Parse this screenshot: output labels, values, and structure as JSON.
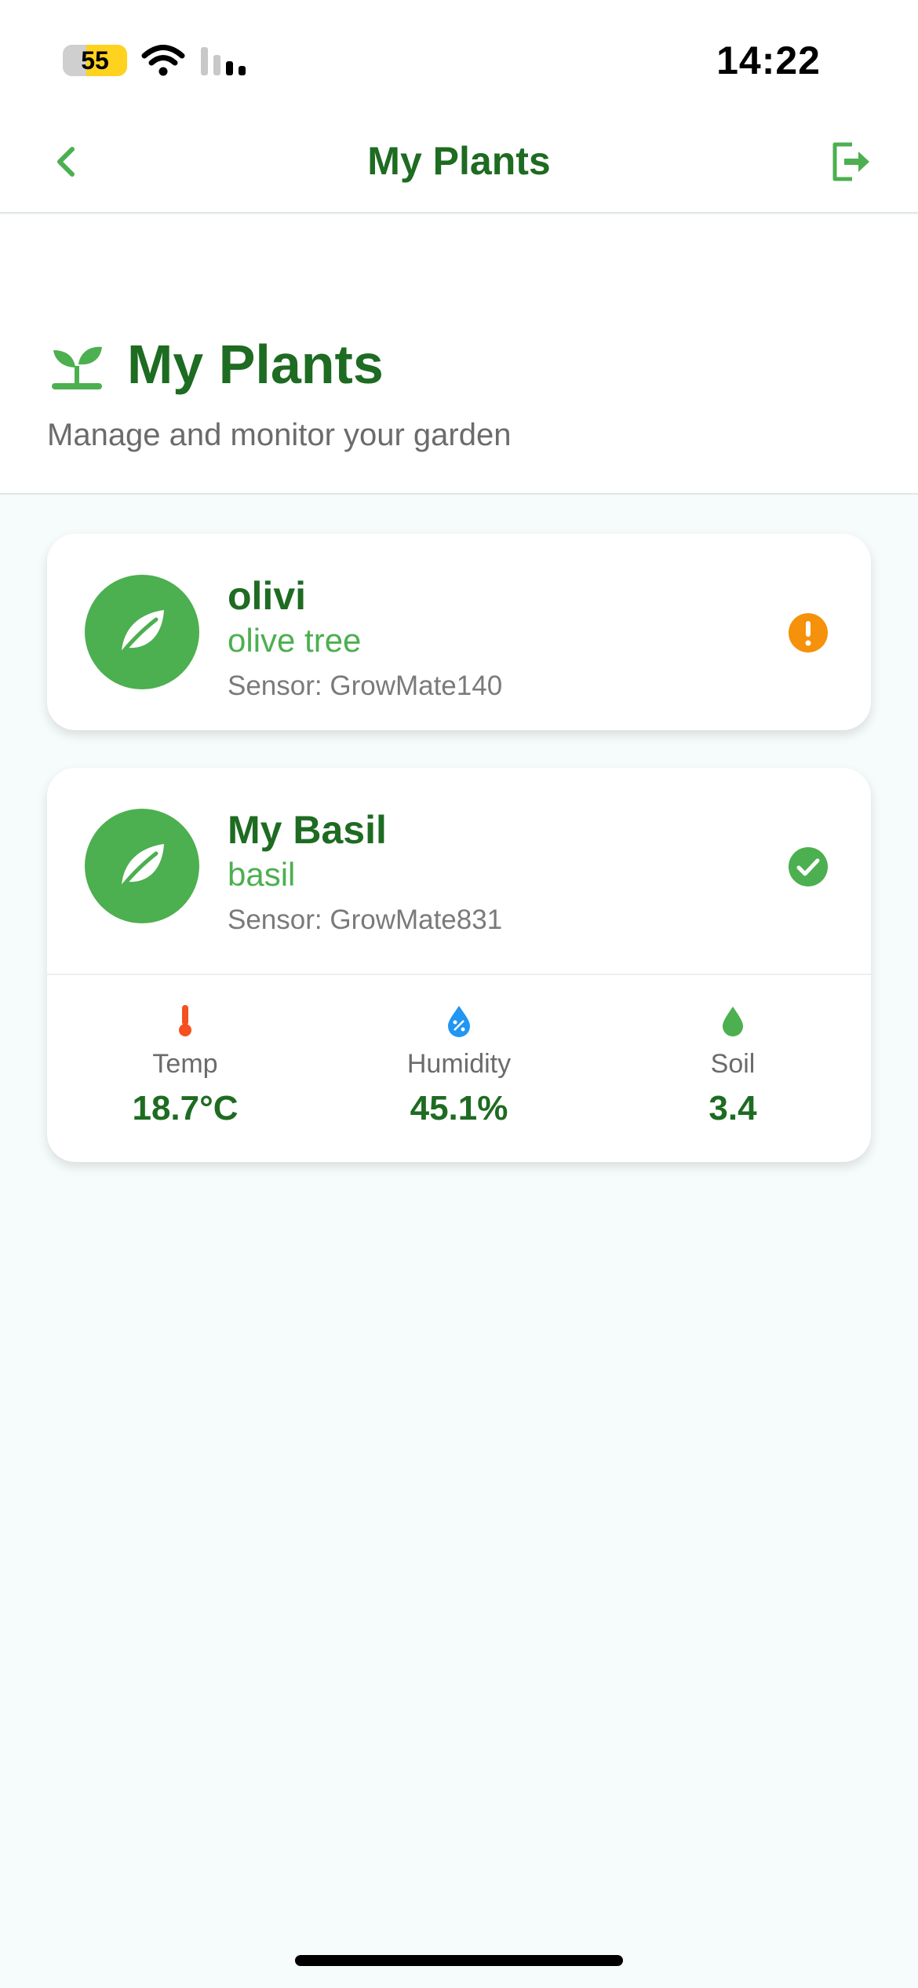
{
  "status_bar": {
    "battery_level": "55",
    "time": "14:22"
  },
  "nav": {
    "title": "My Plants",
    "back_icon": "chevron-left-icon",
    "logout_icon": "logout-icon"
  },
  "header": {
    "title": "My Plants",
    "subtitle": "Manage and monitor your garden",
    "icon": "sprout-icon"
  },
  "plants": [
    {
      "name": "olivi",
      "species": "olive tree",
      "sensor": "Sensor: GrowMate140",
      "status": "warning",
      "status_color": "#f5910a"
    },
    {
      "name": "My Basil",
      "species": "basil",
      "sensor": "Sensor: GrowMate831",
      "status": "ok",
      "status_color": "#4caf50",
      "metrics": [
        {
          "label": "Temp",
          "value": "18.7°C",
          "icon": "thermometer-icon",
          "color": "#f4511e"
        },
        {
          "label": "Humidity",
          "value": "45.1%",
          "icon": "humidity-icon",
          "color": "#2196f3"
        },
        {
          "label": "Soil",
          "value": "3.4",
          "icon": "water-drop-icon",
          "color": "#4caf50"
        }
      ]
    }
  ],
  "colors": {
    "brand_green": "#1e6b22",
    "accent_green": "#4caf50",
    "background": "#f6fcfc"
  }
}
